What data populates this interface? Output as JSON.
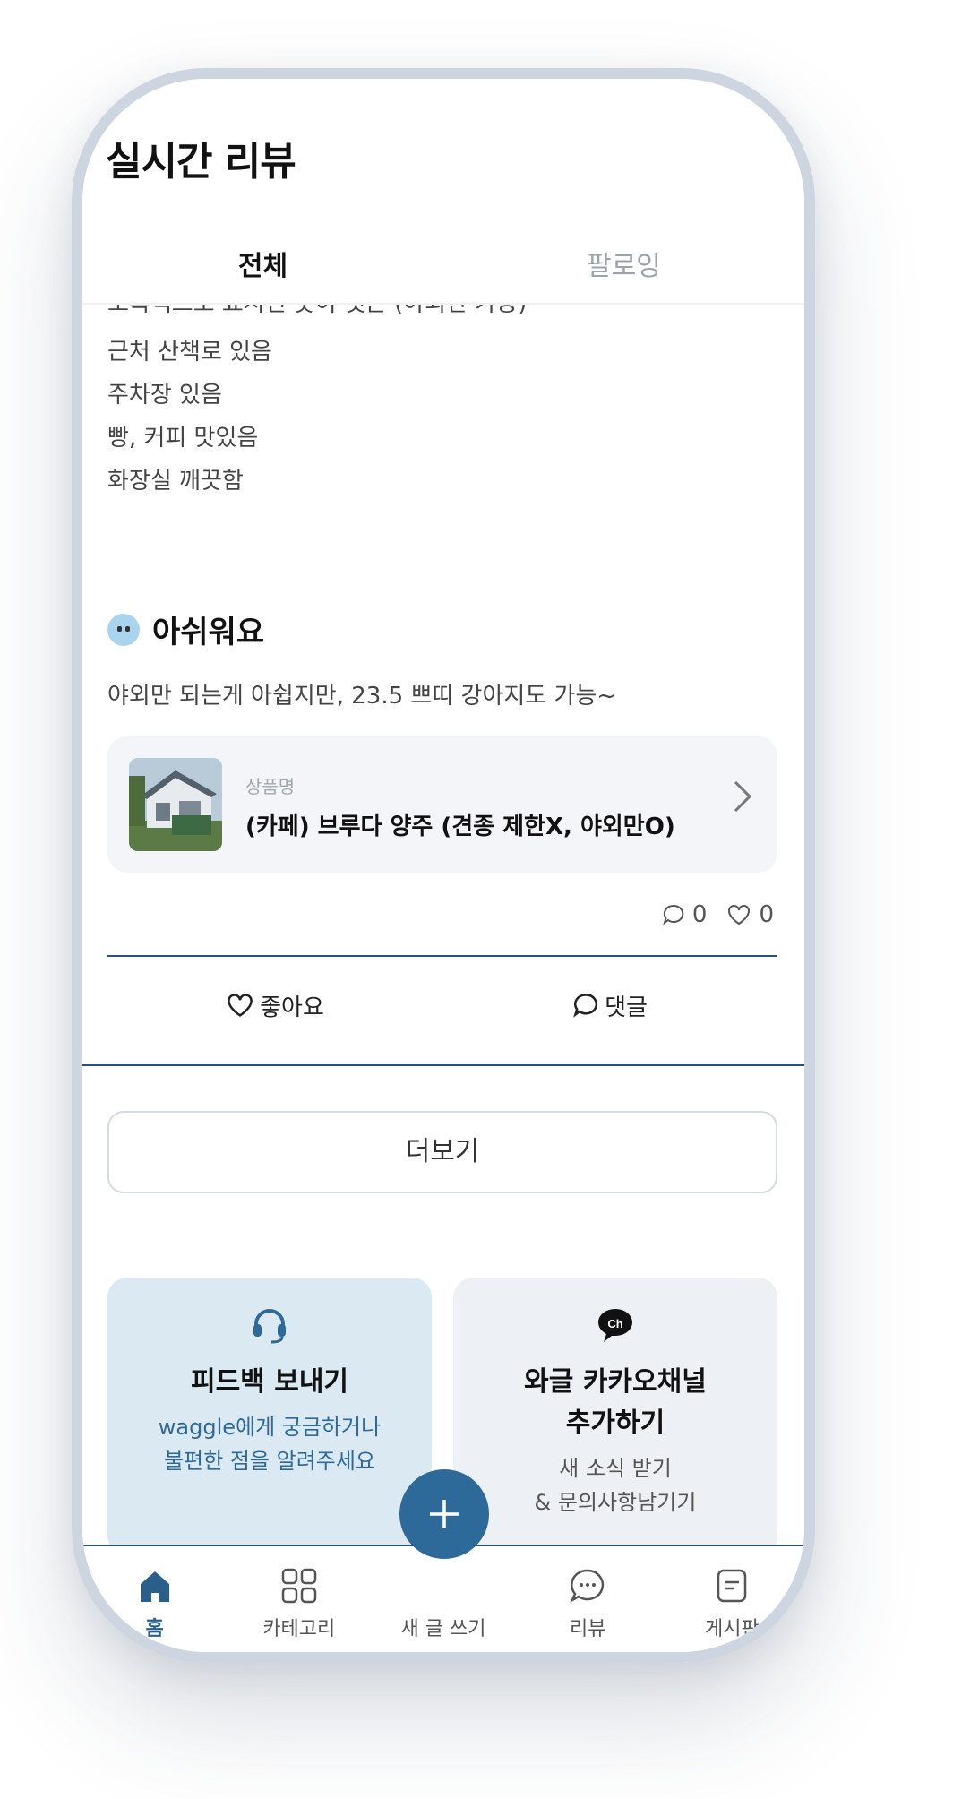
{
  "header": {
    "title": "실시간 리뷰"
  },
  "tabs": [
    {
      "label": "전체",
      "active": true
    },
    {
      "label": "팔로잉",
      "active": false
    }
  ],
  "review": {
    "lines": [
      "초록색으로 표시된 곳이 펫존 (야외만 가능)",
      "근처 산책로 있음",
      "주차장 있음",
      "빵, 커피 맛있음",
      "화장실 깨끗함"
    ],
    "section": {
      "emoji_icon": "sad-face-icon",
      "title": "아쉬워요",
      "text": "야외만 되는게 아쉽지만, 23.5 쁘띠 강아지도 가능~"
    },
    "product": {
      "label": "상품명",
      "name": "(카페) 브루다 양주 (견종 제한X, 야외만O)"
    },
    "counts": {
      "comments": "0",
      "likes": "0"
    },
    "actions": {
      "like_label": "좋아요",
      "comment_label": "댓글"
    }
  },
  "more_label": "더보기",
  "cards": {
    "feedback": {
      "icon": "headset-icon",
      "title": "피드백 보내기",
      "sub1": "waggle에게 궁금하거나",
      "sub2": "불편한 점을 알려주세요"
    },
    "kakao": {
      "icon": "kakao-channel-icon",
      "title1": "와글 카카오채널",
      "title2": "추가하기",
      "sub1": "새 소식 받기",
      "sub2": "& 문의사항남기기"
    }
  },
  "nav": {
    "home": "홈",
    "category": "카테고리",
    "write": "새 글 쓰기",
    "review": "리뷰",
    "board": "게시판"
  },
  "colors": {
    "accent": "#2e6a99",
    "divider": "#2d5176",
    "feedback_bg": "#dbe9f3",
    "kakao_bg": "#edf0f4"
  }
}
